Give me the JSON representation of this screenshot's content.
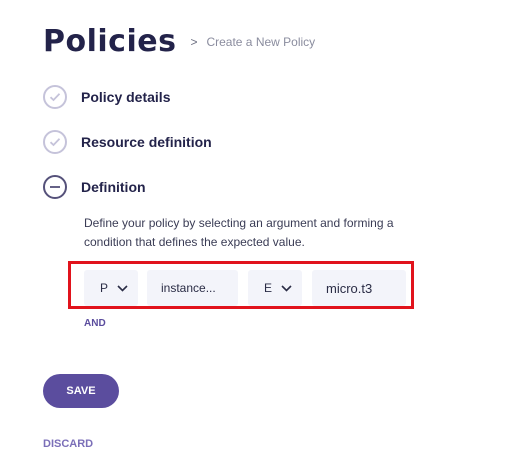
{
  "header": {
    "title": "Policies",
    "breadcrumb_separator": ">",
    "breadcrumb": "Create a New Policy"
  },
  "steps": [
    {
      "label": "Policy details",
      "state": "complete",
      "icon": "check-icon"
    },
    {
      "label": "Resource definition",
      "state": "complete",
      "icon": "check-icon"
    },
    {
      "label": "Definition",
      "state": "active",
      "icon": "minus-icon"
    }
  ],
  "definition": {
    "description": "Define your policy by selecting an argument and forming a condition that defines the expected value.",
    "condition": {
      "type_select": "P",
      "argument": "instance...",
      "operator_select": "E",
      "value": "micro.t3"
    },
    "and_label": "AND"
  },
  "actions": {
    "save_label": "SAVE",
    "discard_label": "DISCARD"
  },
  "colors": {
    "primary": "#5b4d9e",
    "highlight": "#e1131c",
    "field_bg": "#f3f4fa"
  }
}
